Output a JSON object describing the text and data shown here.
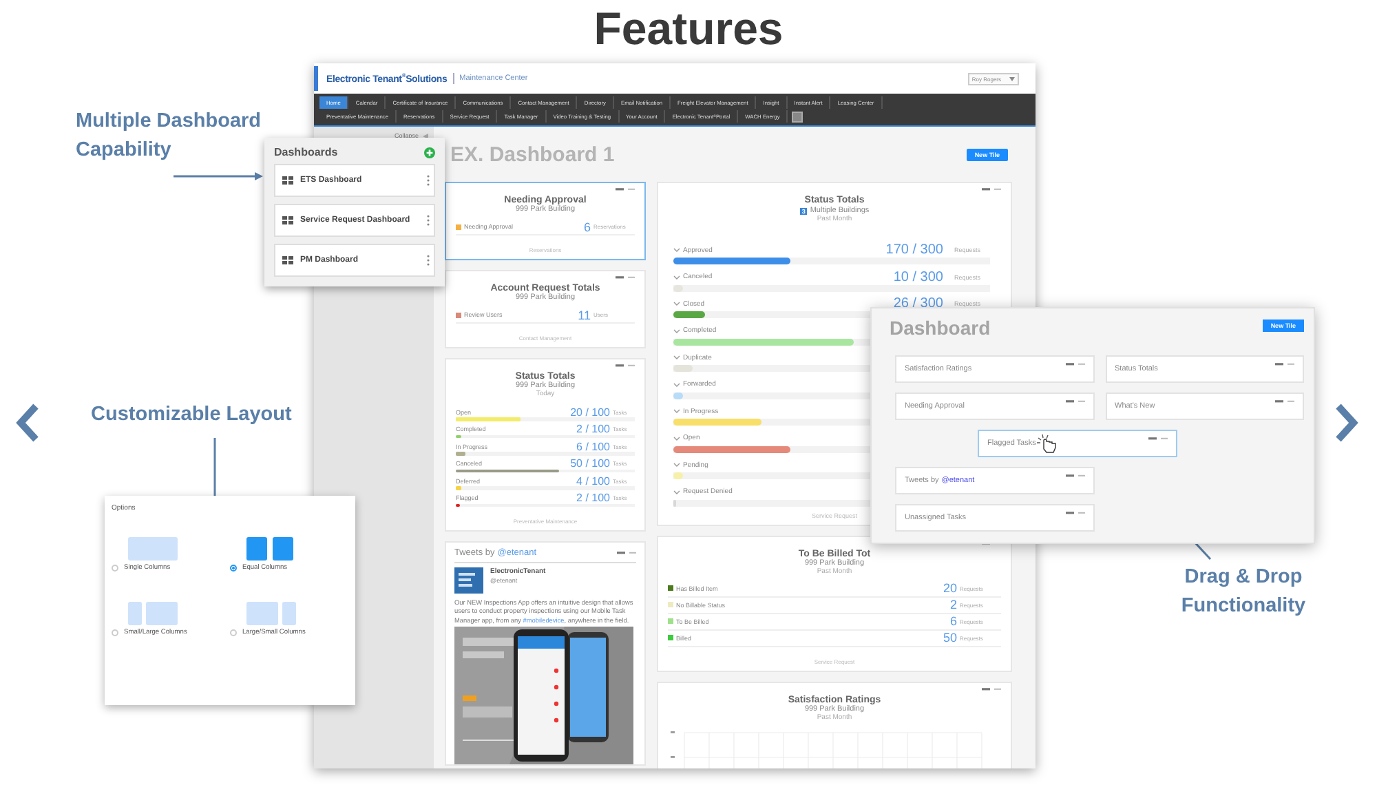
{
  "title": "Features",
  "callouts": [
    {
      "text": "Multiple Dashboard Capability"
    },
    {
      "text": "Customizable Layout"
    },
    {
      "text": "Drag & Drop Functionality"
    }
  ],
  "app": {
    "header": {
      "brand": "Electronic Tenant$^{®}$Solutions",
      "section": "Maintenance Center",
      "user": "Roy Rogers"
    },
    "nav": [
      [
        {
          "label": "Home",
          "selected": true
        },
        {
          "label": "Calendar",
          "selected": false
        },
        {
          "label": "Certificate of Insurance",
          "selected": false
        },
        {
          "label": "Communications",
          "selected": false
        },
        {
          "label": "Contact Management",
          "selected": false
        },
        {
          "label": "Directory",
          "selected": false
        },
        {
          "label": "Email Notification",
          "selected": false
        },
        {
          "label": "Freight Elevator Management",
          "selected": false
        },
        {
          "label": "Insight",
          "selected": false
        },
        {
          "label": "Instant Alert",
          "selected": false
        },
        {
          "label": "Leasing Center",
          "selected": false
        }
      ],
      [
        {
          "label": "Preventative Maintenance",
          "selected": false
        },
        {
          "label": "Reservations",
          "selected": false
        },
        {
          "label": "Service Request",
          "selected": false
        },
        {
          "label": "Task Manager",
          "selected": false
        },
        {
          "label": "Video Training & Testing",
          "selected": false
        },
        {
          "label": "Your Account",
          "selected": false
        },
        {
          "label": "Electronic Tenant$^{®}$Portal",
          "selected": false
        },
        {
          "label": "WACH Energy",
          "selected": false
        }
      ]
    ],
    "collapse": "Collapse",
    "page_title": "EX. Dashboard 1",
    "new_tile": "New Tile",
    "left_column": [
      {
        "kind": "count",
        "selected": true,
        "title": "Needing Approval",
        "subtitle": "999 Park Building",
        "rows": [
          {
            "label": "Needing Approval",
            "value": "6",
            "unit": "Reservations",
            "color": "#f5b041"
          }
        ],
        "footer": "Reservations"
      },
      {
        "kind": "count",
        "selected": false,
        "title": "Account Request Totals",
        "subtitle": "999 Park Building",
        "rows": [
          {
            "label": "Review Users",
            "value": "11",
            "unit": "Users",
            "color": "#d98a7a"
          }
        ],
        "footer": "Contact Management"
      },
      {
        "kind": "progress",
        "selected": false,
        "title": "Status Totals",
        "subtitle": "999 Park Building",
        "period": "Today",
        "rows": [
          {
            "label": "Open",
            "value": "20 / 100",
            "unit": "Tasks",
            "level": 0.36,
            "color": "#f2ec6a"
          },
          {
            "label": "Completed",
            "value": "2 / 100",
            "unit": "Tasks",
            "level": 0.03,
            "color": "#8fd16b"
          },
          {
            "label": "In Progress",
            "value": "6 / 100",
            "unit": "Tasks",
            "level": 0.05,
            "color": "#b0b090"
          },
          {
            "label": "Canceled",
            "value": "50 / 100",
            "unit": "Tasks",
            "level": 0.58,
            "color": "#9a9a88"
          },
          {
            "label": "Deferred",
            "value": "4 / 100",
            "unit": "Tasks",
            "level": 0.03,
            "color": "#f5d442"
          },
          {
            "label": "Flagged",
            "value": "2 / 100",
            "unit": "Tasks",
            "level": 0.02,
            "color": "#e02020"
          }
        ],
        "footer": "Preventative Maintenance"
      },
      {
        "kind": "tweets",
        "selected": false,
        "title": "Tweets by",
        "handle": "@etenant",
        "account": "ElectronicTenant",
        "account_handle": "@etenant",
        "text_before": "Our NEW Inspections App offers an intuitive design that allows users to conduct property inspections using our Mobile Task Manager app, from any",
        "hashtag": "#mobiledevice",
        "text_after": ", anywhere in the field."
      }
    ],
    "right_column": [
      {
        "kind": "grouped-progress",
        "selected": false,
        "title": "Status Totals",
        "badge": "3",
        "badge_label": "Multiple Buildings",
        "period": "Past Month",
        "rows": [
          {
            "label": "Approved",
            "value": "170 / 300",
            "unit": "Requests",
            "level": 0.37,
            "color": "#3d8ee8"
          },
          {
            "label": "Canceled",
            "value": "10 / 300",
            "unit": "Requests",
            "level": 0.03,
            "color": "#e6e6de"
          },
          {
            "label": "Closed",
            "value": "26 / 300",
            "unit": "Requests",
            "level": 0.1,
            "color": "#5aa844"
          },
          {
            "label": "Completed",
            "level": 0.57,
            "color": "#a8e6a0"
          },
          {
            "label": "Duplicate",
            "level": 0.06,
            "color": "#e4e4da"
          },
          {
            "label": "Forwarded",
            "level": 0.03,
            "color": "#b8dcf7"
          },
          {
            "label": "In Progress",
            "level": 0.28,
            "color": "#f7df6a"
          },
          {
            "label": "Open",
            "level": 0.37,
            "color": "#e58a7a"
          },
          {
            "label": "Pending",
            "level": 0.03,
            "color": "#f7f0a8"
          },
          {
            "label": "Request Denied",
            "level": 0.01,
            "color": "#d8d8d8"
          }
        ],
        "footer": "Service Request"
      },
      {
        "kind": "count",
        "selected": false,
        "title": "To Be Billed Tot",
        "subtitle": "999 Park Building",
        "period": "Past Month",
        "rows": [
          {
            "label": "Has Billed Item",
            "value": "20",
            "unit": "Requests",
            "color": "#4c7a1e"
          },
          {
            "label": "No Billable Status",
            "value": "2",
            "unit": "Requests",
            "color": "#eeeac0"
          },
          {
            "label": "To Be Billed",
            "value": "6",
            "unit": "Requests",
            "color": "#9fe08a"
          },
          {
            "label": "Billed",
            "value": "50",
            "unit": "Requests",
            "color": "#3ccc3c"
          }
        ],
        "footer": "Service Request"
      },
      {
        "kind": "chart",
        "selected": false,
        "title": "Satisfaction Ratings",
        "subtitle": "999 Park Building",
        "period": "Past Month"
      }
    ]
  },
  "dashboards": {
    "title": "Dashboards",
    "items": [
      {
        "label": "ETS Dashboard"
      },
      {
        "label": "Service Request Dashboard"
      },
      {
        "label": "PM Dashboard"
      }
    ]
  },
  "options": {
    "title": "Options",
    "items": [
      {
        "kind": "single",
        "label": "Single Columns",
        "selected": false
      },
      {
        "kind": "equal",
        "label": "Equal Columns",
        "selected": true
      },
      {
        "kind": "small-large",
        "label": "Small/Large Columns",
        "selected": false
      },
      {
        "kind": "large-small",
        "label": "Large/Small Columns",
        "selected": false
      }
    ]
  },
  "drag_panel": {
    "title": "Dashboard",
    "new_tile": "New Tile",
    "rows": [
      [
        {
          "label": "Satisfaction Ratings",
          "dragging": false
        },
        {
          "label": "Status Totals",
          "dragging": false
        }
      ],
      [
        {
          "label": "Needing Approval",
          "dragging": false
        },
        {
          "label": "What's New",
          "dragging": false
        }
      ],
      [
        {
          "label": "Flagged Tasks",
          "dragging": true
        }
      ],
      [
        {
          "label": "Tweets by",
          "handle": "@etenant",
          "dragging": false
        }
      ],
      [
        {
          "label": "Unassigned Tasks",
          "dragging": false
        }
      ]
    ]
  }
}
